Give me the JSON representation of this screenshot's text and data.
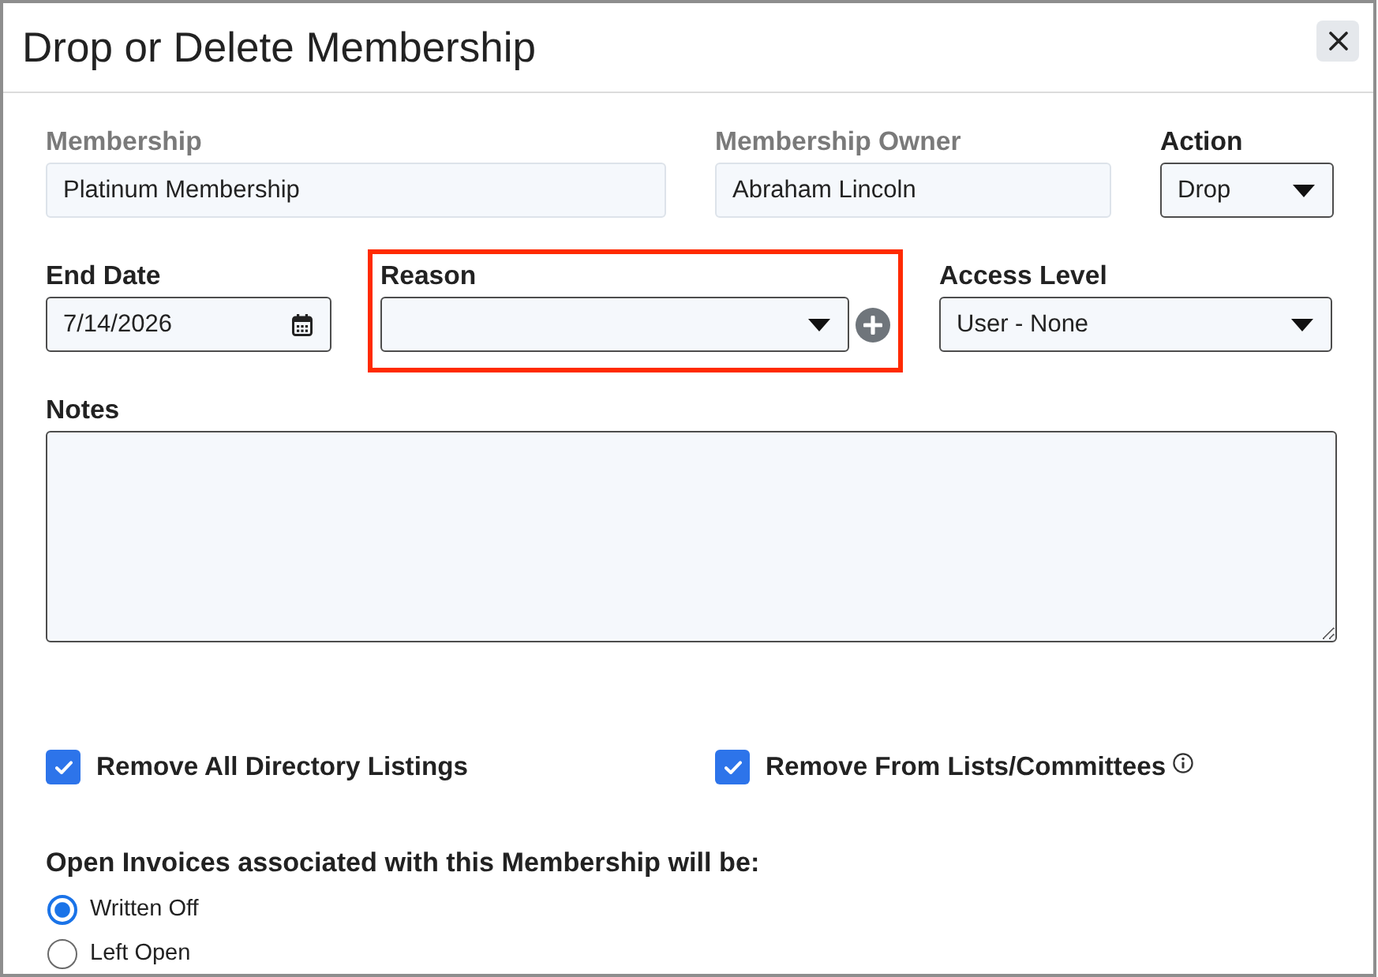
{
  "dialog": {
    "title": "Drop or Delete Membership"
  },
  "field_rows": [
    {
      "fields": [
        {
          "kind": "text",
          "label": "Membership",
          "value": "Platinum Membership",
          "disabled": true,
          "highlighted": false,
          "add_button": false
        },
        {
          "kind": "text",
          "label": "Membership Owner",
          "value": "Abraham Lincoln",
          "disabled": true,
          "highlighted": false,
          "add_button": false
        },
        {
          "kind": "select",
          "label": "Action",
          "value": "Drop",
          "disabled": false,
          "highlighted": false,
          "add_button": false
        }
      ]
    },
    {
      "fields": [
        {
          "kind": "date",
          "label": "End Date",
          "value": "7/14/2026",
          "disabled": false,
          "highlighted": false,
          "add_button": false
        },
        {
          "kind": "select",
          "label": "Reason",
          "disabled": false,
          "highlighted": true,
          "add_button": true
        },
        {
          "kind": "select",
          "label": "Access Level",
          "value": "User - None",
          "disabled": false,
          "highlighted": false,
          "add_button": false
        }
      ]
    }
  ],
  "notes": {
    "label": "Notes"
  },
  "checkboxes": [
    {
      "label": "Remove All Directory Listings",
      "checked": true,
      "info": false
    },
    {
      "label": "Remove From Lists/Committees",
      "checked": true,
      "info": true
    }
  ],
  "invoices": {
    "prompt": "Open Invoices associated with this Membership will be:",
    "options": [
      {
        "label": "Written Off",
        "selected": true
      },
      {
        "label": "Left Open",
        "selected": false
      }
    ]
  }
}
